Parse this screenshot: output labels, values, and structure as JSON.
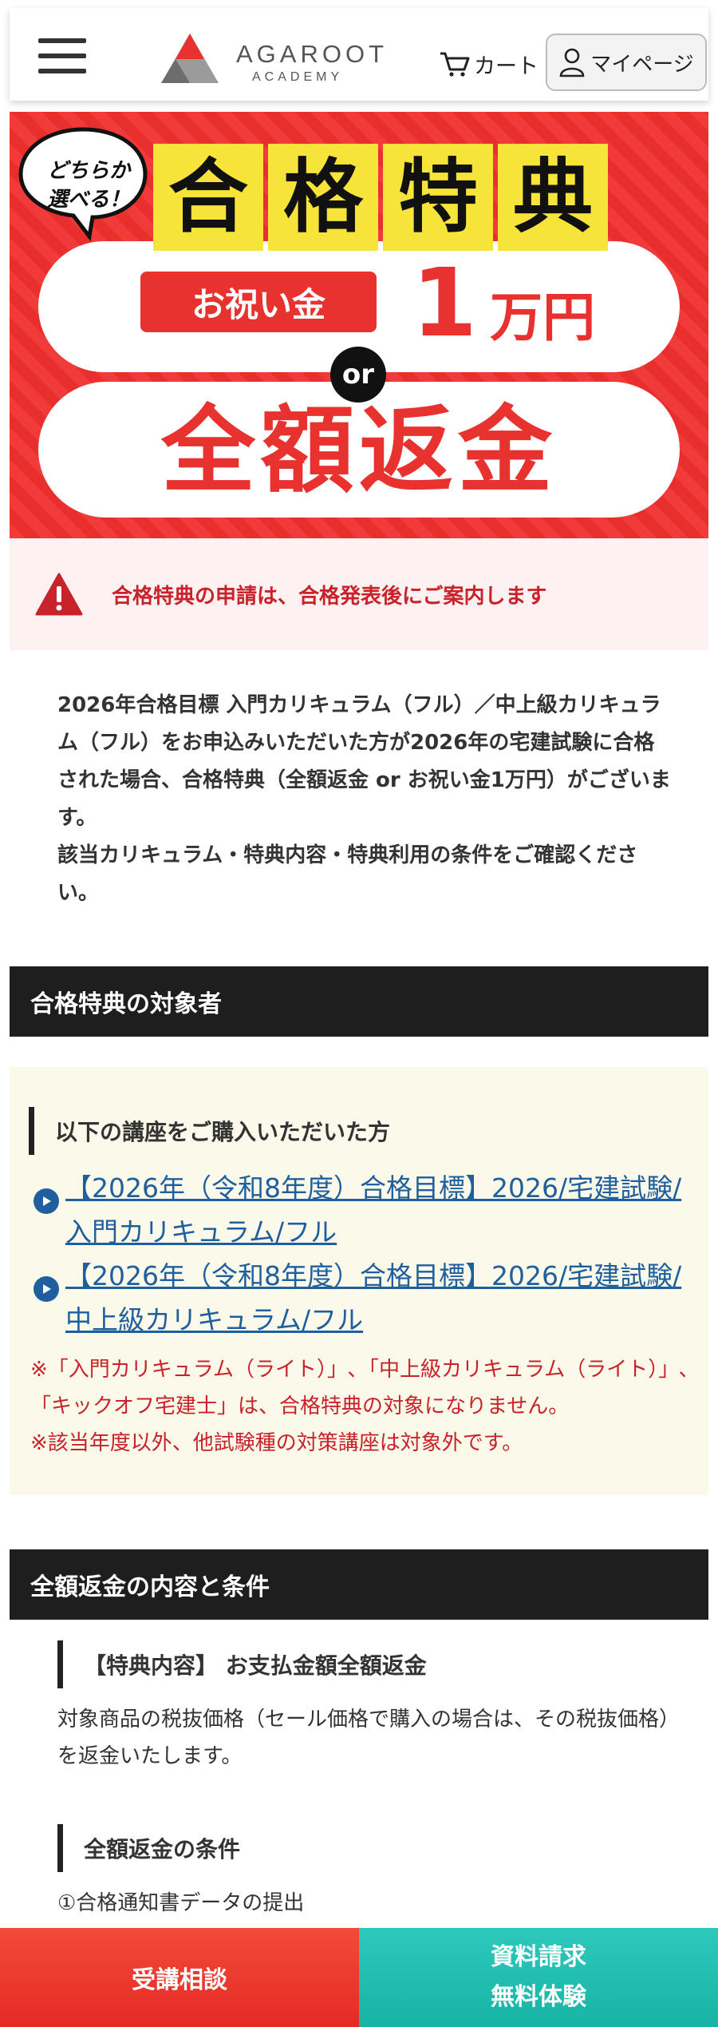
{
  "header": {
    "logo_brand": "AGAROOT",
    "logo_sub": "ACADEMY",
    "cart_label": "カート",
    "mypage_label": "マイページ"
  },
  "banner": {
    "bubble_text": "どちらか選べる！",
    "title_chars": [
      "合",
      "格",
      "特",
      "典"
    ],
    "oiwai_label": "お祝い金",
    "amount_number": "1",
    "amount_unit": "万円",
    "or_label": "or",
    "full_refund": "全額返金",
    "colors": {
      "red": "#e8322f",
      "yellow": "#f7e43a"
    }
  },
  "alert": {
    "icon": "warning-icon",
    "text": "合格特典の申請は、合格発表後にご案内します"
  },
  "intro": {
    "line1": "2026年合格目標 入門カリキュラム（フル）／中上級カリキュラム（フル）をお申込みいただいた方が2026年の宅建試験に合格された場合、合格特典（全額返金 or お祝い金1万円）がございます。",
    "line2": "該当カリキュラム・特典内容・特典利用の条件をご確認ください。"
  },
  "target_section": {
    "heading": "合格特典の対象者",
    "sub_heading": "以下の講座をご購入いただいた方",
    "links": [
      "【2026年（令和8年度）合格目標】2026/宅建試験/入門カリキュラム/フル",
      "【2026年（令和8年度）合格目標】2026/宅建試験/中上級カリキュラム/フル"
    ],
    "note1": "※「入門カリキュラム（ライト）」､「中上級カリキュラム（ライト）」､「キックオフ宅建士」は、合格特典の対象になりません。",
    "note2": "※該当年度以外、他試験種の対策講座は対象外です。"
  },
  "refund_section": {
    "heading": "全額返金の内容と条件",
    "content_heading": "【特典内容】 お支払金額全額返金",
    "content_text": "対象商品の税抜価格（セール価格で購入の場合は、その税抜価格）を返金いたします。",
    "conditions_heading": "全額返金の条件",
    "condition1": "①合格通知書データの提出"
  },
  "cta": {
    "consult": "受講相談",
    "request": "資料請求",
    "trial": "無料体験"
  }
}
